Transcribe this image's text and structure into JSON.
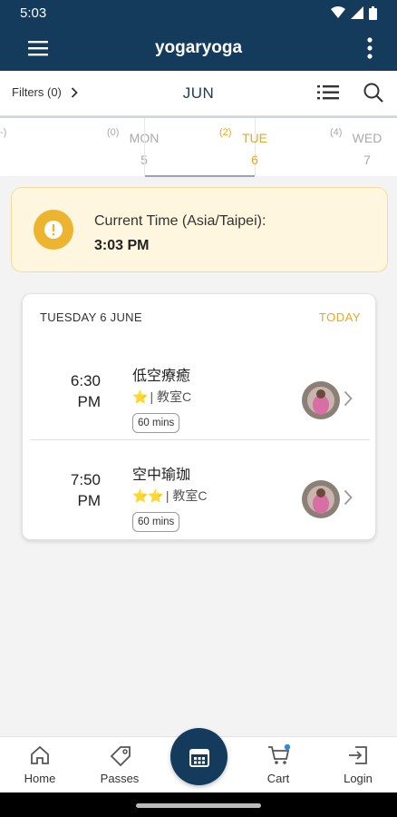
{
  "status_bar": {
    "time": "5:03"
  },
  "app_bar": {
    "title": "yogaryoga"
  },
  "sub_bar": {
    "filters_label": "Filters (0)",
    "month": "JUN"
  },
  "days": [
    {
      "name": "",
      "number": "",
      "count": "-)"
    },
    {
      "name": "MON",
      "number": "5",
      "count": "(0)"
    },
    {
      "name": "TUE",
      "number": "6",
      "count": "(2)",
      "active": true
    },
    {
      "name": "WED",
      "number": "7",
      "count": "(4)"
    }
  ],
  "current_time": {
    "label": "Current Time (Asia/Taipei):",
    "value": "3:03 PM"
  },
  "schedule": {
    "date_header": "TUESDAY 6 JUNE",
    "today_label": "TODAY",
    "classes": [
      {
        "time_line1": "6:30",
        "time_line2": "PM",
        "name": "低空療癒",
        "stars": "⭐",
        "room": "| 教室C",
        "duration": "60 mins"
      },
      {
        "time_line1": "7:50",
        "time_line2": "PM",
        "name": "空中瑜珈",
        "stars": "⭐⭐",
        "room": "| 教室C",
        "duration": "60 mins"
      }
    ]
  },
  "tab_bar": {
    "home": "Home",
    "passes": "Passes",
    "cart": "Cart",
    "login": "Login"
  },
  "colors": {
    "primary": "#143a5c",
    "accent": "#e4a91d",
    "notice_bg": "#fff6e0"
  },
  "icons": [
    "menu-icon",
    "more-vert-icon",
    "chevron-right-icon",
    "list-icon",
    "search-icon",
    "info-icon",
    "home-icon",
    "tag-icon",
    "calendar-icon",
    "cart-icon",
    "login-icon"
  ]
}
